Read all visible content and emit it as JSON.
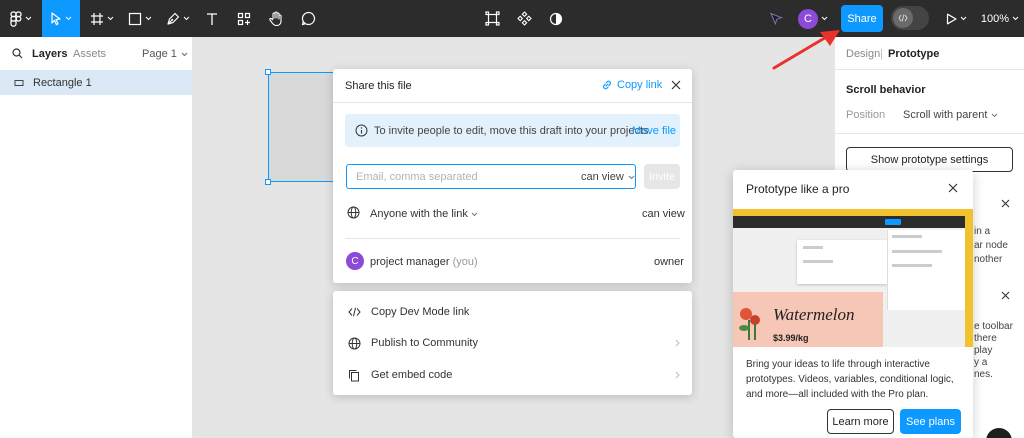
{
  "toolbar": {
    "share_label": "Share",
    "avatar_letter": "C",
    "zoom": "100%"
  },
  "left_panel": {
    "tab_layers": "Layers",
    "tab_assets": "Assets",
    "page_selector": "Page 1",
    "layers": [
      {
        "name": "Rectangle 1"
      }
    ]
  },
  "right_panel": {
    "tab_design": "Design",
    "tab_separator": "|",
    "tab_prototype": "Prototype",
    "section_title": "Scroll behavior",
    "position_label": "Position",
    "position_value": "Scroll with parent",
    "show_settings_button": "Show prototype settings",
    "partial_text_1": [
      "in a",
      "ar node",
      "nother"
    ],
    "partial_text_2": [
      "e toolbar",
      "there",
      "play",
      "y a",
      "nes."
    ]
  },
  "share_dialog": {
    "title": "Share this file",
    "copy_link": "Copy link",
    "info_text": "To invite people to edit, move this draft into your projects.",
    "move_file": "Move file",
    "email_placeholder": "Email, comma separated",
    "permission_select": "can view",
    "invite_button": "Invite",
    "anyone_label": "Anyone with the link",
    "anyone_permission": "can view",
    "member_avatar": "C",
    "member_name": "project manager",
    "member_you": "(you)",
    "member_role": "owner"
  },
  "share_menu": {
    "items": [
      {
        "label": "Copy Dev Mode link"
      },
      {
        "label": "Publish to Community"
      },
      {
        "label": "Get embed code"
      }
    ]
  },
  "promo": {
    "title": "Prototype like a pro",
    "preview_product": "Watermelon",
    "preview_price": "$3.99/kg",
    "description": "Bring your ideas to life through interactive prototypes. Videos, variables, conditional logic, and more—all included with the Pro plan.",
    "learn_more": "Learn more",
    "see_plans": "See plans"
  },
  "colors": {
    "toolbar_bg": "#2c2c2c",
    "accent": "#0d99ff",
    "avatar": "#8b4bd8",
    "annotation_arrow": "#e8322b"
  }
}
